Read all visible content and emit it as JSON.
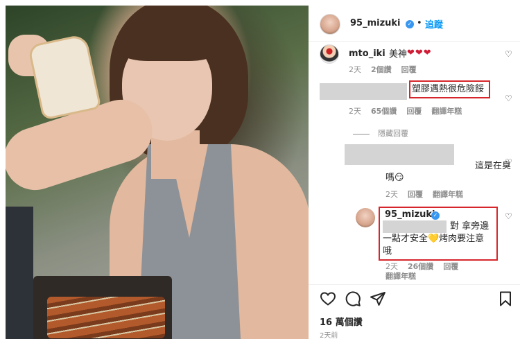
{
  "post": {
    "username": "95_mizuki",
    "follow_label": "追蹤",
    "dot": "•",
    "likes": "16 萬個讚",
    "date": "2天前"
  },
  "comments": {
    "c1": {
      "username": "mto_iki",
      "text": "美神",
      "hearts": "❤❤❤",
      "time": "2天",
      "likes": "2個讚",
      "reply": "回覆"
    },
    "c2": {
      "text": "塑膠遇熱很危險餒",
      "time": "2天",
      "likes": "65個讚",
      "reply": "回覆",
      "translate": "翻譯年糕"
    },
    "hide_replies": "隱藏回覆",
    "c3": {
      "text_line1": "這是在臭",
      "text_line2": "嗎😏",
      "time": "2天",
      "reply": "回覆",
      "translate": "翻譯年糕"
    },
    "c4": {
      "username": "95_mizuki",
      "line1": "對 拿旁邊",
      "line2": "一點才安全💛烤肉要注意",
      "line3": "哦",
      "time": "2天",
      "likes": "26個讚",
      "reply": "回覆",
      "translate": "翻譯年糕"
    }
  },
  "icons": {
    "heart": "♡",
    "verified": "✓"
  }
}
